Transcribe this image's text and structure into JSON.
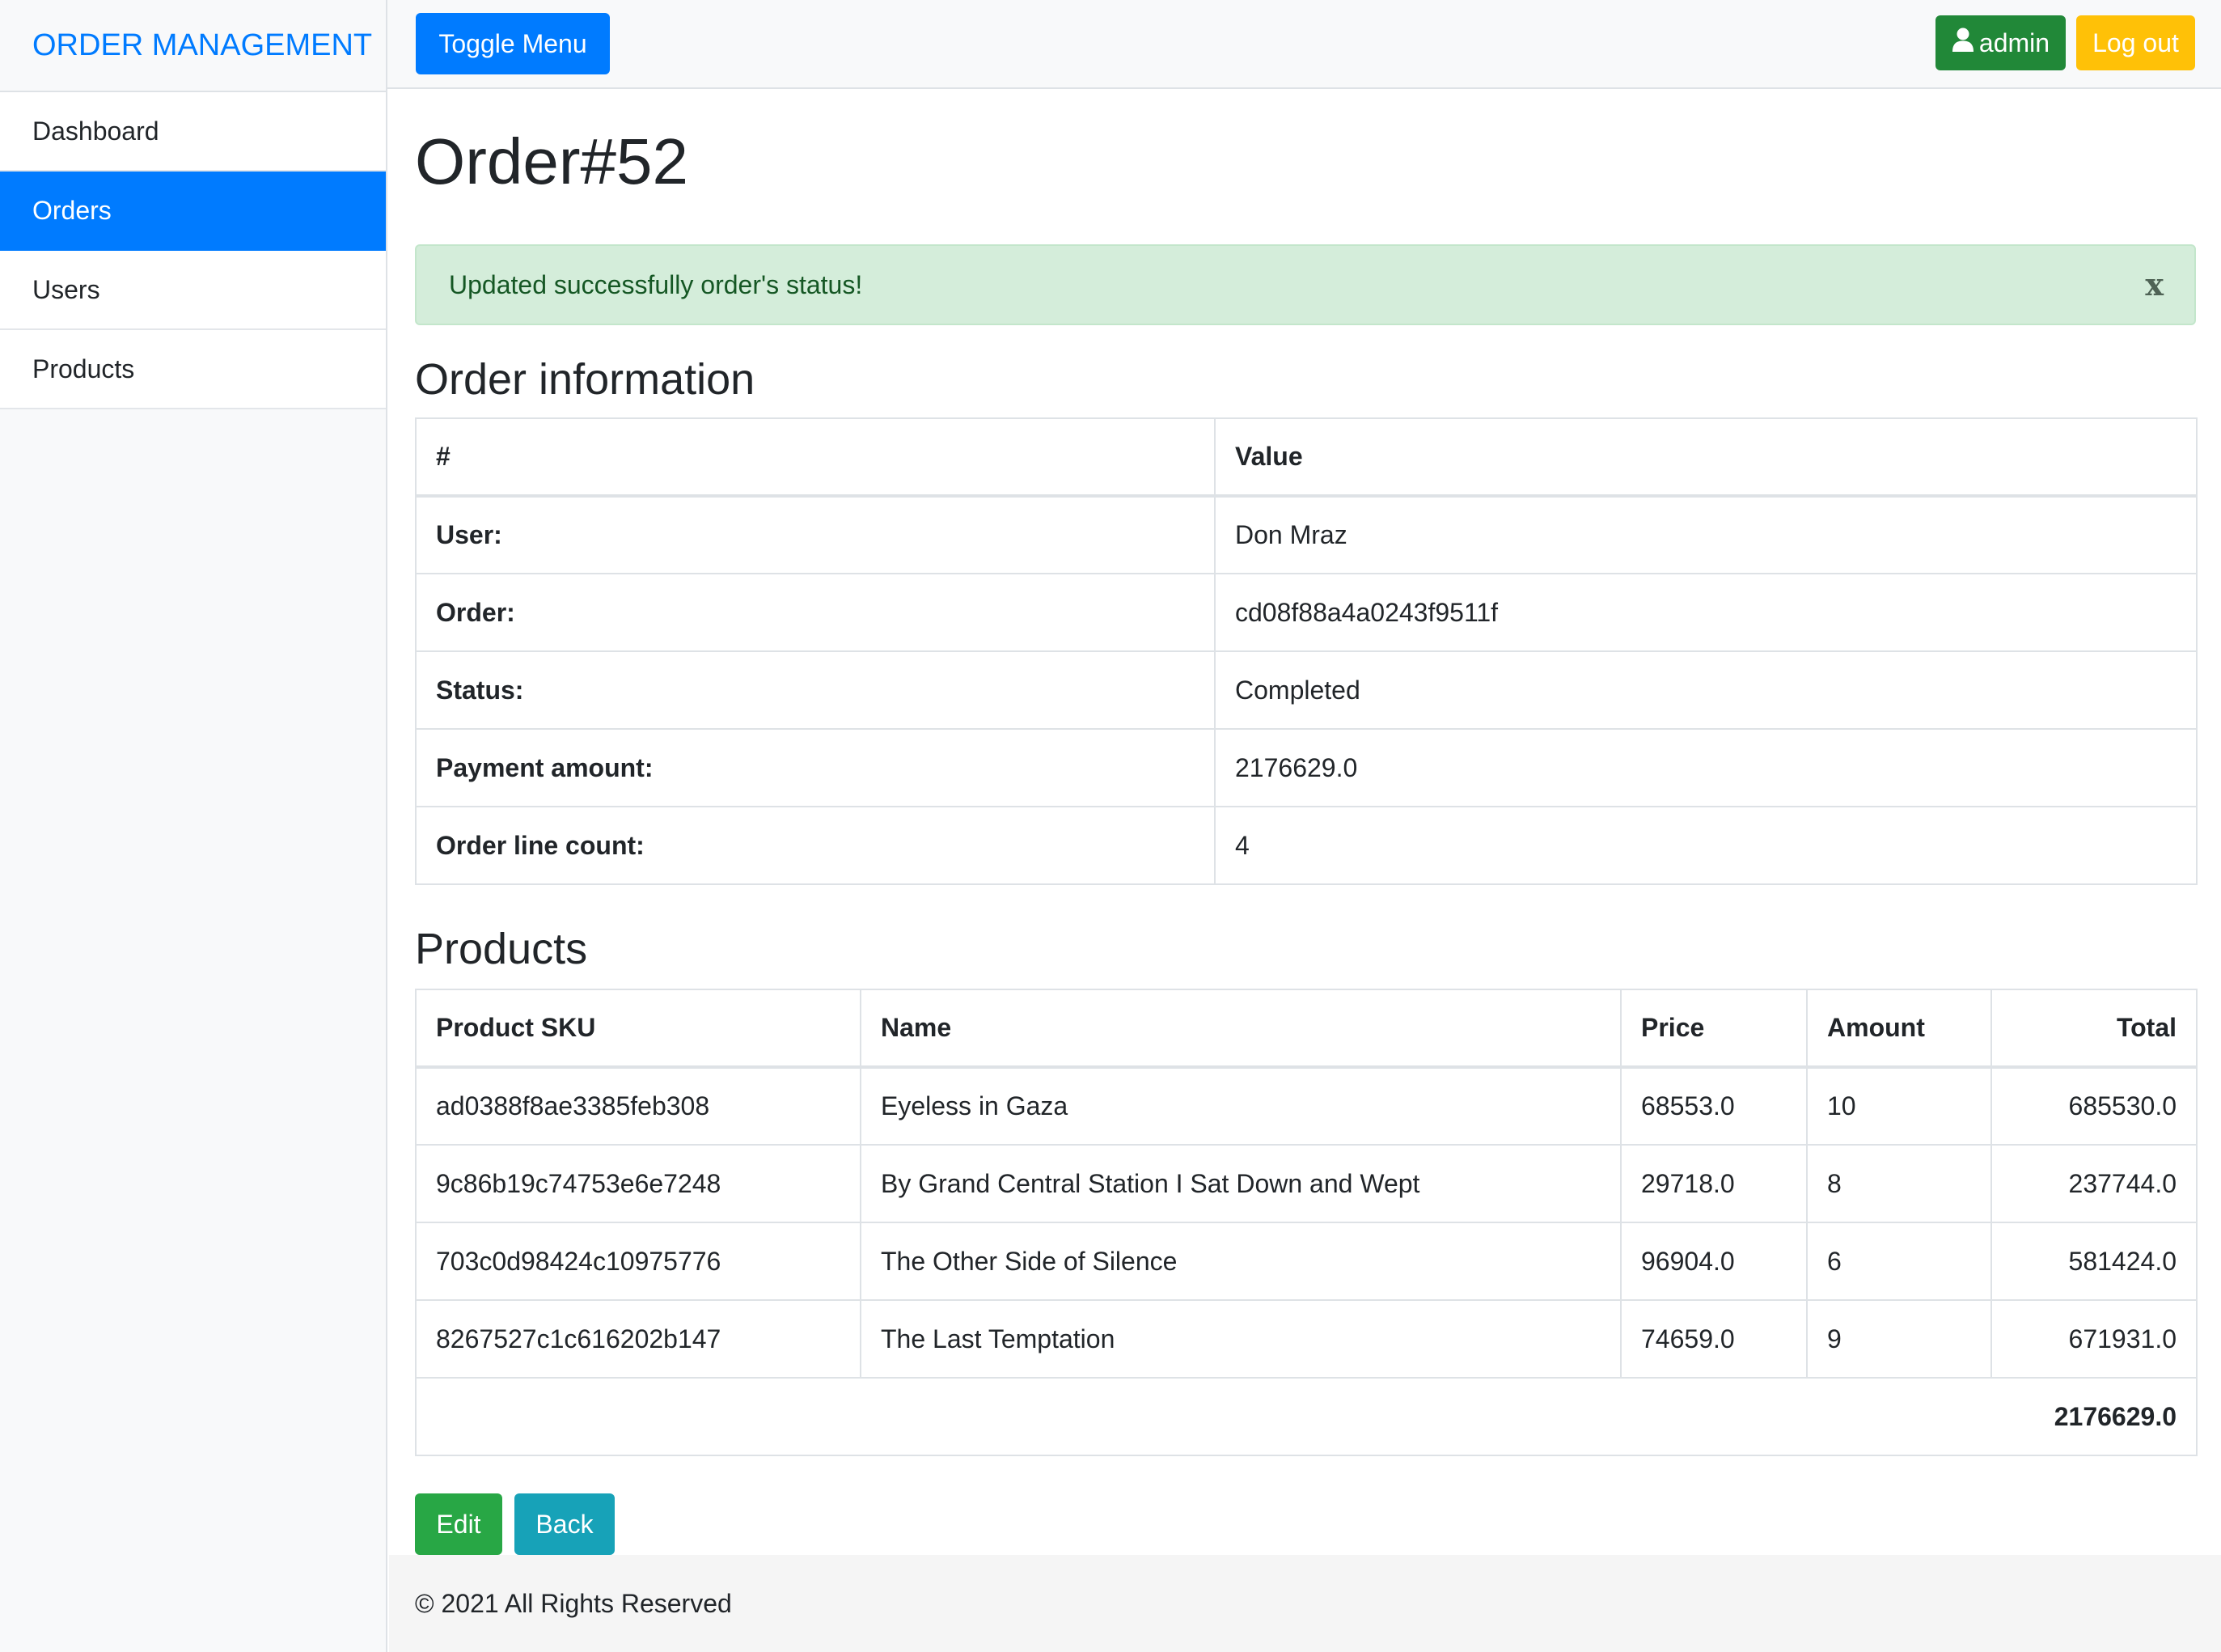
{
  "sidebar": {
    "brand": "ORDER MANAGEMENT",
    "items": [
      {
        "label": "Dashboard"
      },
      {
        "label": "Orders"
      },
      {
        "label": "Users"
      },
      {
        "label": "Products"
      }
    ]
  },
  "topbar": {
    "toggle_label": "Toggle Menu",
    "user_label": "admin",
    "logout_label": "Log out"
  },
  "main": {
    "title": "Order#52",
    "alert": {
      "message": "Updated successfully order's status!",
      "close": "x"
    },
    "order_info": {
      "title": "Order information",
      "headers": [
        "#",
        "Value"
      ],
      "rows": [
        {
          "label": "User:",
          "value": "Don Mraz"
        },
        {
          "label": "Order:",
          "value": "cd08f88a4a0243f9511f"
        },
        {
          "label": "Status:",
          "value": "Completed"
        },
        {
          "label": "Payment amount:",
          "value": "2176629.0"
        },
        {
          "label": "Order line count:",
          "value": "4"
        }
      ]
    },
    "products": {
      "title": "Products",
      "headers": [
        "Product SKU",
        "Name",
        "Price",
        "Amount",
        "Total"
      ],
      "rows": [
        {
          "sku": "ad0388f8ae3385feb308",
          "name": "Eyeless in Gaza",
          "price": "68553.0",
          "amount": "10",
          "total": "685530.0"
        },
        {
          "sku": "9c86b19c74753e6e7248",
          "name": "By Grand Central Station I Sat Down and Wept",
          "price": "29718.0",
          "amount": "8",
          "total": "237744.0"
        },
        {
          "sku": "703c0d98424c10975776",
          "name": "The Other Side of Silence",
          "price": "96904.0",
          "amount": "6",
          "total": "581424.0"
        },
        {
          "sku": "8267527c1c616202b147",
          "name": "The Last Temptation",
          "price": "74659.0",
          "amount": "9",
          "total": "671931.0"
        }
      ],
      "grand_total": "2176629.0"
    },
    "edit_label": "Edit",
    "back_label": "Back"
  },
  "footer": {
    "text": "© 2021 All Rights Reserved"
  }
}
